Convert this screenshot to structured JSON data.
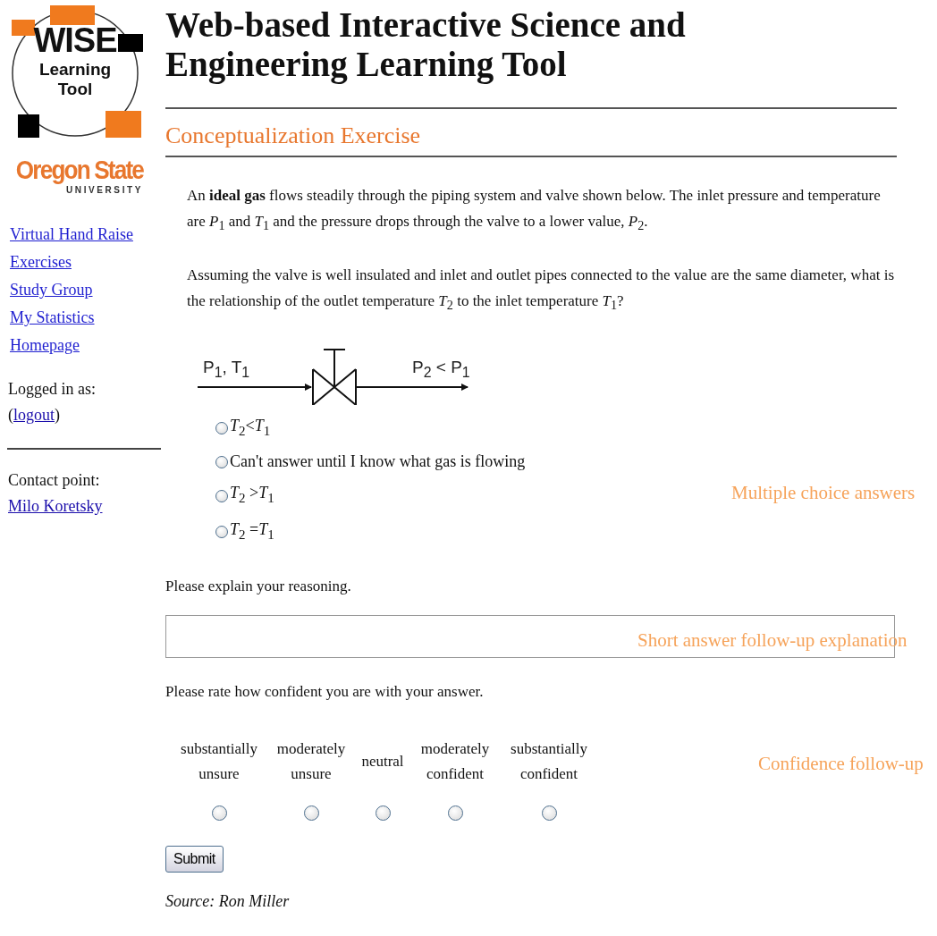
{
  "logo": {
    "line_1": "WISE",
    "line_2": "Learning",
    "line_3": "Tool"
  },
  "university": {
    "name": "Oregon State",
    "subtitle": "UNIVERSITY"
  },
  "sidebar": {
    "links": [
      "Virtual Hand Raise",
      "Exercises",
      "Study Group",
      "My Statistics",
      "Homepage"
    ],
    "logged_in_label": "Logged in as:",
    "logout_line": {
      "before": "(",
      "link": "logout",
      "after": ")"
    },
    "contact_label": "Contact point:",
    "contact_link": "Milo Koretsky"
  },
  "page_title": "Web-based Interactive Science and Engineering Learning Tool",
  "section_title": "Conceptualization Exercise",
  "question": {
    "paragraphs": [
      "An **ideal gas** flows steadily through the piping system and valve shown below. The inlet pressure and temperature are *P*$_{1}$ and *T*$_{1}$ and the pressure drops through the valve to a lower value, *P*$_{2}$.",
      "Assuming the valve is well insulated and inlet and outlet pipes connected to the value are the same diameter, what is the relationship of the outlet temperature *T*$_{2}$ to the inlet temperature *T*$_{1}$?"
    ]
  },
  "diagram": {
    "inlet_label": "P$_{1}$, T$_{1}$",
    "outlet_label": "P$_{2}$ < P$_{1}$"
  },
  "options": [
    {
      "label": "*T*$_{2}$<*T*$_{1}$",
      "selected": false
    },
    {
      "label": "Can't answer until I know what gas is flowing",
      "selected": false
    },
    {
      "label": "*T*$_{2}$ >*T*$_{1}$",
      "selected": false
    },
    {
      "label": "*T*$_{2}$ =*T*$_{1}$",
      "selected": false
    }
  ],
  "explain_prompt": "Please explain your reasoning.",
  "confidence_prompt": "Please rate how confident you are with your answer.",
  "confidence_scale": [
    {
      "label": "substantially unsure",
      "selected": false
    },
    {
      "label": "moderately unsure",
      "selected": false
    },
    {
      "label": "neutral",
      "selected": false
    },
    {
      "label": "moderately confident",
      "selected": false
    },
    {
      "label": "substantially confident",
      "selected": false
    }
  ],
  "submit_button": "Submit",
  "source": "Source: Ron Miller",
  "annotations": [
    {
      "text": "Multiple choice answers"
    },
    {
      "text": "Short answer follow-up explanation"
    },
    {
      "text": "Confidence follow-up"
    }
  ]
}
